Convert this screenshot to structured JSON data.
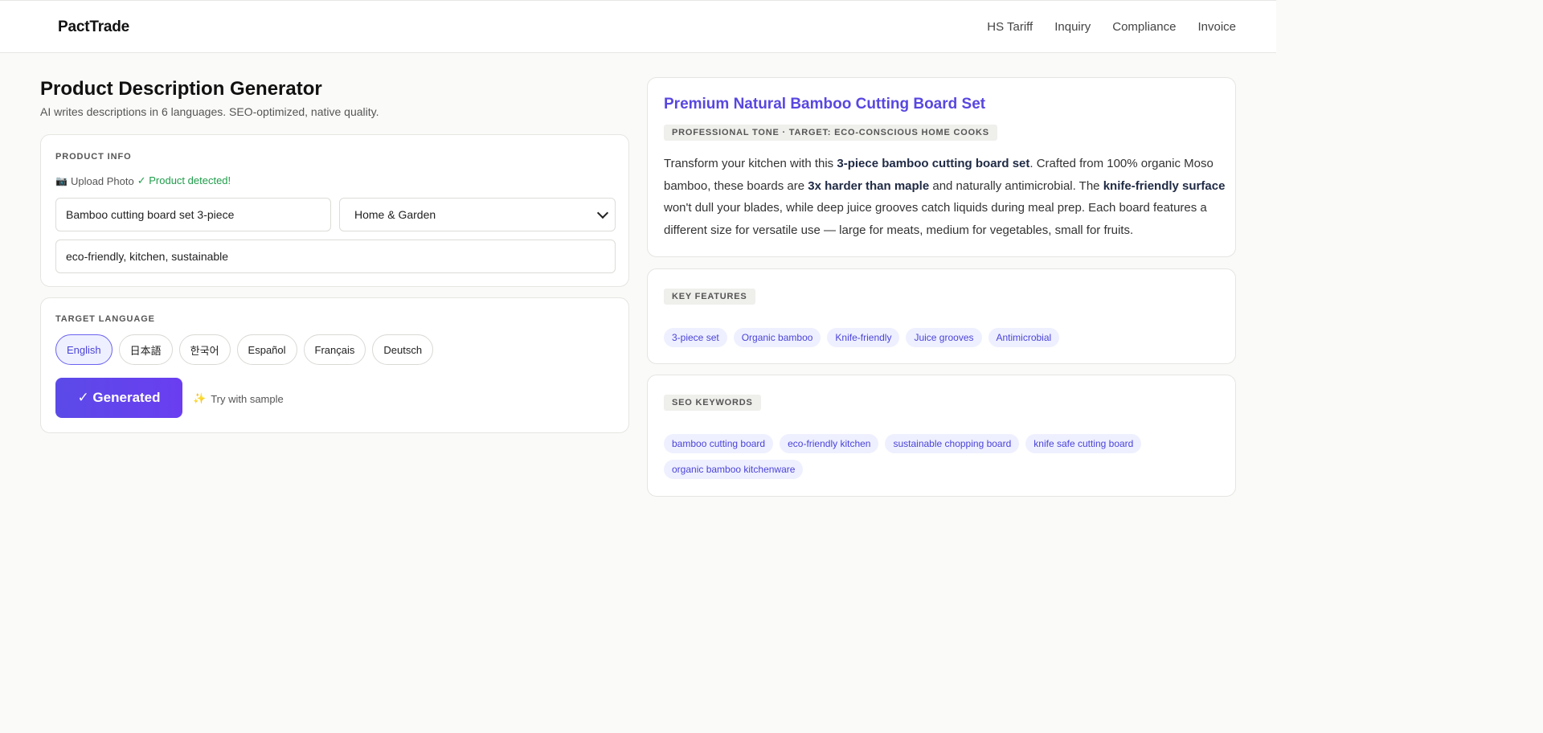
{
  "header": {
    "brand": "PactTrade",
    "nav": [
      "HS Tariff",
      "Inquiry",
      "Compliance",
      "Invoice"
    ]
  },
  "page": {
    "title": "Product Description Generator",
    "subtitle": "AI writes descriptions in 6 languages. SEO-optimized, native quality."
  },
  "product_info": {
    "label": "PRODUCT INFO",
    "upload_label": "Upload Photo",
    "detected": "✓ Product detected!",
    "product_name": "Bamboo cutting board set 3-piece",
    "category": "Home & Garden",
    "keywords": "eco-friendly, kitchen, sustainable"
  },
  "target_language": {
    "label": "TARGET LANGUAGE",
    "options": [
      "English",
      "日本語",
      "한국어",
      "Español",
      "Français",
      "Deutsch"
    ],
    "selected": "English"
  },
  "actions": {
    "generate_label": "✓ Generated",
    "sample_label": "Try with sample"
  },
  "result": {
    "title": "Premium Natural Bamboo Cutting Board Set",
    "tone_badge": "PROFESSIONAL TONE · TARGET: ECO-CONSCIOUS HOME COOKS",
    "desc_segments": [
      "Transform your kitchen with this ",
      "3-piece bamboo cutting board set",
      ". Crafted from 100% organic Moso bamboo, these boards are ",
      "3x harder than maple",
      " and naturally antimicrobial. The ",
      "knife-friendly surface",
      " won't dull your blades, while deep juice grooves catch liquids during meal prep. Each board features a different size for versatile use — large for meats, medium for vegetables, small for fruits."
    ]
  },
  "key_features": {
    "label": "KEY FEATURES",
    "items": [
      "3-piece set",
      "Organic bamboo",
      "Knife-friendly",
      "Juice grooves",
      "Antimicrobial"
    ]
  },
  "seo_keywords": {
    "label": "SEO KEYWORDS",
    "items": [
      "bamboo cutting board",
      "eco-friendly kitchen",
      "sustainable chopping board",
      "knife safe cutting board",
      "organic bamboo kitchenware"
    ]
  },
  "colors": {
    "accent": "#5847e0",
    "success": "#1f9d4a",
    "chip_bg": "#eef0ff"
  }
}
